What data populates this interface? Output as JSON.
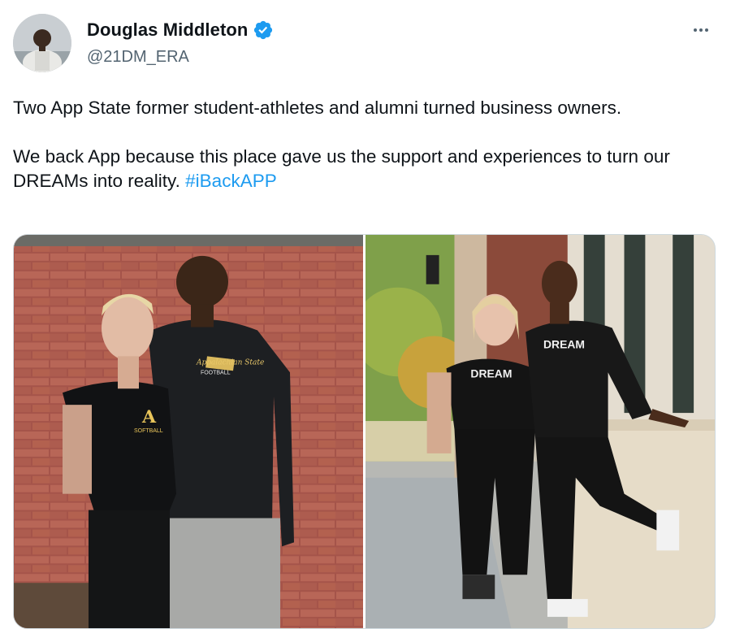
{
  "author": {
    "display_name": "Douglas Middleton",
    "handle": "@21DM_ERA",
    "verified": true,
    "avatar_icon": "profile-photo"
  },
  "more_icon": "ellipsis-icon",
  "tweet": {
    "paragraph_1": "Two App State former student-athletes and alumni turned business owners.",
    "paragraph_2": "We back App because this place gave us the support and experiences to turn our DREAMs into reality.",
    "hashtag": "#iBackAPP"
  },
  "media": {
    "photo_1": {
      "shirt_text": "A",
      "shirt_subtext": "SOFTBALL",
      "jacket_text": "Appalachian State",
      "jacket_subtext": "FOOTBALL"
    },
    "photo_2": {
      "shirt_text_woman": "DREAM",
      "shirt_text_man": "DREAM"
    }
  },
  "colors": {
    "link": "#1d9bf0",
    "verified": "#1d9bf0",
    "secondary_text": "#536471",
    "primary_text": "#0f1419"
  }
}
